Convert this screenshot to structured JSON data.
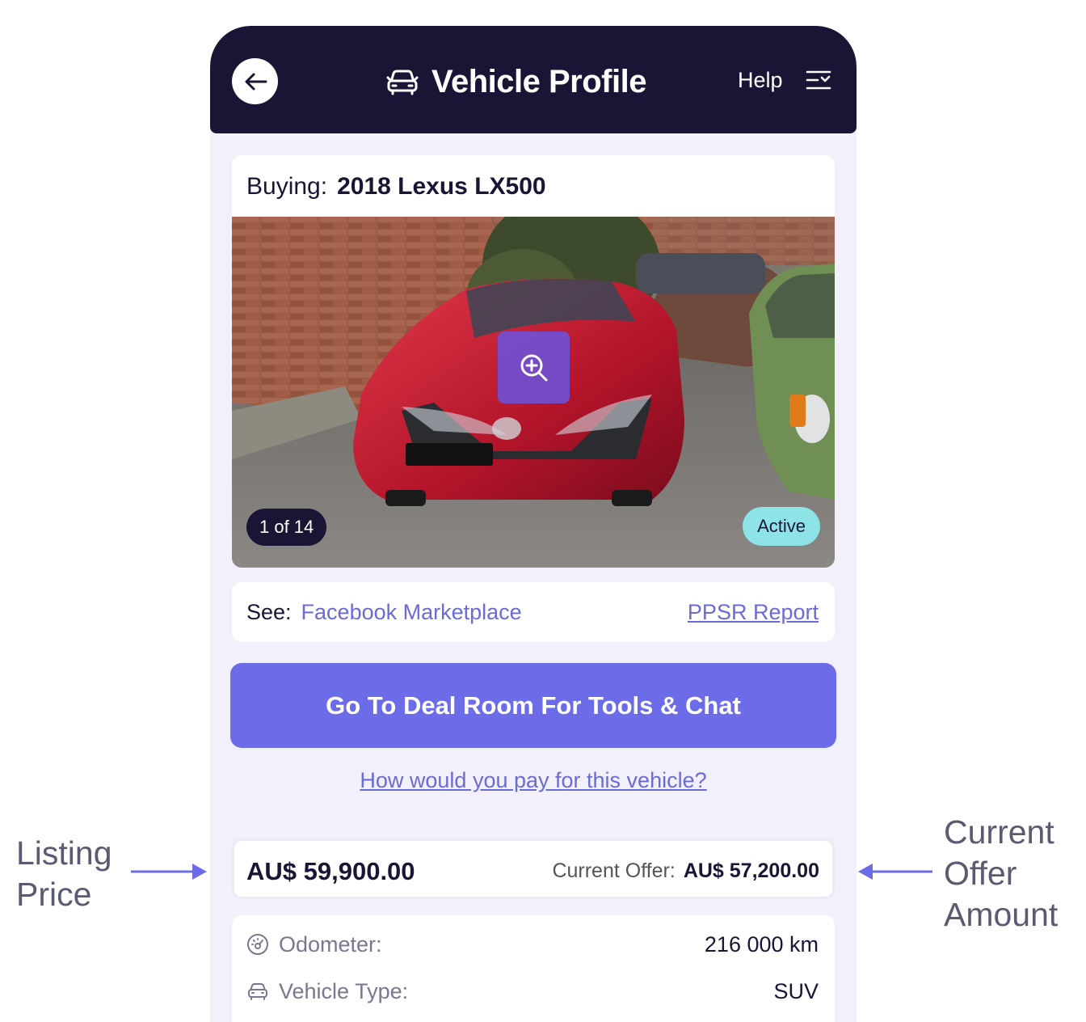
{
  "header": {
    "title": "Vehicle Profile",
    "help_label": "Help"
  },
  "vehicle": {
    "buying_label": "Buying:",
    "name": "2018 Lexus LX500",
    "photo_counter": "1 of 14",
    "status": "Active"
  },
  "links": {
    "see_label": "See:",
    "source_link": "Facebook Marketplace",
    "report_link": "PPSR Report"
  },
  "actions": {
    "deal_room_button": "Go To Deal Room For Tools & Chat",
    "payment_link": "How would you pay for this vehicle?"
  },
  "pricing": {
    "listing_price": "AU$ 59,900.00",
    "offer_label": "Current Offer:",
    "offer_value": "AU$ 57,200.00"
  },
  "specs": [
    {
      "label": "Odometer:",
      "value": "216 000 km",
      "icon": "speedometer-icon"
    },
    {
      "label": "Vehicle Type:",
      "value": "SUV",
      "icon": "car-icon"
    }
  ],
  "annotations": {
    "left": [
      "Listing",
      "Price"
    ],
    "right": [
      "Current",
      "Offer",
      "Amount"
    ]
  },
  "colors": {
    "header_bg": "#1b1535",
    "accent": "#6c6ce8",
    "link": "#6b6bd8",
    "status_active": "#8de3e6",
    "page_bg": "#f1f0fb"
  }
}
